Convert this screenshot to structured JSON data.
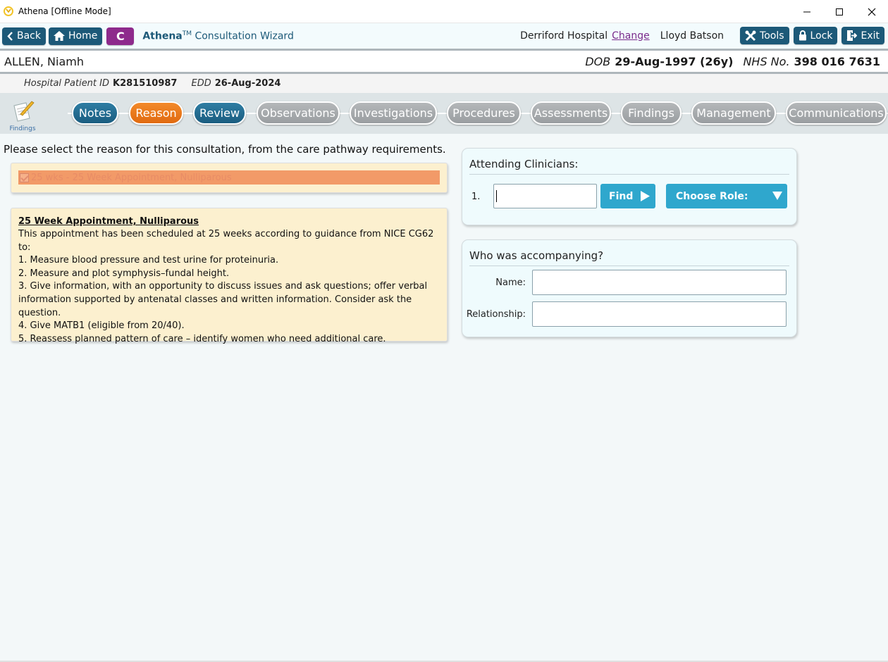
{
  "window": {
    "title": "Athena [Offline Mode]",
    "controls": [
      "minimize-icon",
      "maximize-icon",
      "close-icon"
    ]
  },
  "toolbar": {
    "back_label": "Back",
    "home_label": "Home",
    "c_label": "C",
    "brand_name": "Athena",
    "brand_tm": "TM",
    "brand_suffix": "Consultation Wizard",
    "hospital": "Derriford Hospital",
    "change_label": "Change",
    "user": "Lloyd Batson",
    "tools_label": "Tools",
    "lock_label": "Lock",
    "exit_label": "Exit"
  },
  "patient": {
    "name": "ALLEN, Niamh",
    "dob_label": "DOB",
    "dob_value": "29-Aug-1997 (26y)",
    "nhs_label": "NHS No.",
    "nhs_value": "398 016 7631",
    "hospital_id_label": "Hospital Patient ID",
    "hospital_id_value": "K281510987",
    "edd_label": "EDD",
    "edd_value": "26-Aug-2024"
  },
  "wizard": {
    "findings_icon_label": "Findings",
    "steps": [
      {
        "label": "Notes",
        "state": "done"
      },
      {
        "label": "Reason",
        "state": "active"
      },
      {
        "label": "Review",
        "state": "done"
      },
      {
        "label": "Observations",
        "state": "todo"
      },
      {
        "label": "Investigations",
        "state": "todo"
      },
      {
        "label": "Procedures",
        "state": "todo"
      },
      {
        "label": "Assessments",
        "state": "todo"
      },
      {
        "label": "Findings",
        "state": "todo"
      },
      {
        "label": "Management",
        "state": "todo"
      },
      {
        "label": "Communications",
        "state": "todo"
      }
    ]
  },
  "main": {
    "instruction": "Please select the reason for this consultation, from the care pathway requirements.",
    "reason_item": "25 wks - 25 Week Appointment, Nulliparous",
    "info": {
      "title": "25 Week Appointment, Nulliparous",
      "lines": [
        "This appointment has been scheduled at 25 weeks according to guidance from NICE CG62 to:",
        "1. Measure blood pressure and test urine for proteinuria.",
        "2. Measure and plot symphysis–fundal height.",
        "3. Give information, with an opportunity to discuss issues and ask questions; offer verbal",
        "information supported by antenatal classes and written information. Consider ask the question.",
        "4. Give MATB1 (eligible from 20/40).",
        "5. Reassess planned pattern of care – identify women who need additional care."
      ]
    }
  },
  "clinicians": {
    "title": "Attending Clinicians:",
    "row_number": "1.",
    "input_value": "",
    "find_label": "Find",
    "role_label": "Choose Role:"
  },
  "accompanying": {
    "title": "Who was accompanying?",
    "name_label": "Name:",
    "name_value": "",
    "relationship_label": "Relationship:",
    "relationship_value": ""
  },
  "colors": {
    "toolbar_button": "#1c5978",
    "c_button": "#8e2a8c",
    "step_done": "#1b5d80",
    "step_active": "#e06a10",
    "step_todo": "#9a9ea1",
    "action_button": "#2fa7cd",
    "reason_highlight": "#f29a68",
    "info_background": "#fcf0cf"
  }
}
